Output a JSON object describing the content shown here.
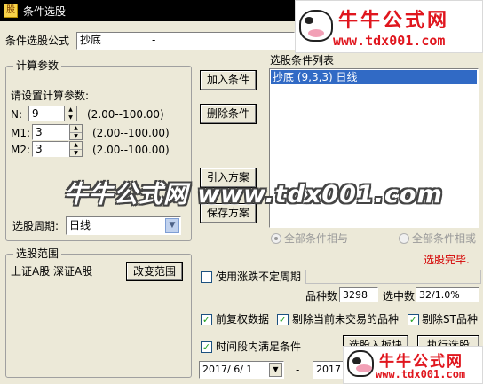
{
  "window": {
    "title": "条件选股",
    "icon": "app-icon"
  },
  "formula": {
    "label": "条件选股公式",
    "value": "抄底",
    "dash": "-"
  },
  "params": {
    "group_label": "计算参数",
    "prompt": "请设置计算参数:",
    "rows": [
      {
        "name": "N:",
        "value": "9",
        "range": "(2.00--100.00)"
      },
      {
        "name": "M1:",
        "value": "3",
        "range": "(2.00--100.00)"
      },
      {
        "name": "M2:",
        "value": "3",
        "range": "(2.00--100.00)"
      }
    ],
    "period_label": "选股周期:",
    "period_value": "日线"
  },
  "buttons": {
    "add": "加入条件",
    "delete": "删除条件",
    "import": "引入方案",
    "save": "保存方案",
    "change_range": "改变范围",
    "to_block": "选股入板块",
    "execute": "执行选股"
  },
  "conditions": {
    "label": "选股条件列表",
    "items": [
      "抄底 (9,3,3) 日线"
    ]
  },
  "match": {
    "all_and": "全部条件相与",
    "all_or": "全部条件相或"
  },
  "status": {
    "text": "选股完毕.",
    "color": "#d40000"
  },
  "range": {
    "group_label": "选股范围",
    "value": "上证A股 深证A股"
  },
  "options": {
    "variable_period": "使用涨跌不定周期",
    "forward_adjust": "前复权数据",
    "exclude_untraded": "剔除当前未交易的品种",
    "exclude_st": "剔除ST品种",
    "time_period": "时间段内满足条件"
  },
  "stats": {
    "total_label": "品种数",
    "total_value": "3298",
    "selected_label": "选中数",
    "selected_value": "32/1.0%"
  },
  "dates": {
    "start": "2017/ 6/ 1",
    "separator": "-",
    "end": "2017"
  },
  "watermark": {
    "brand": "牛牛公式网",
    "url": "www.tdx001.com",
    "overlay": "牛牛公式网 www.tdx001.com",
    "color": "#e0161e"
  }
}
